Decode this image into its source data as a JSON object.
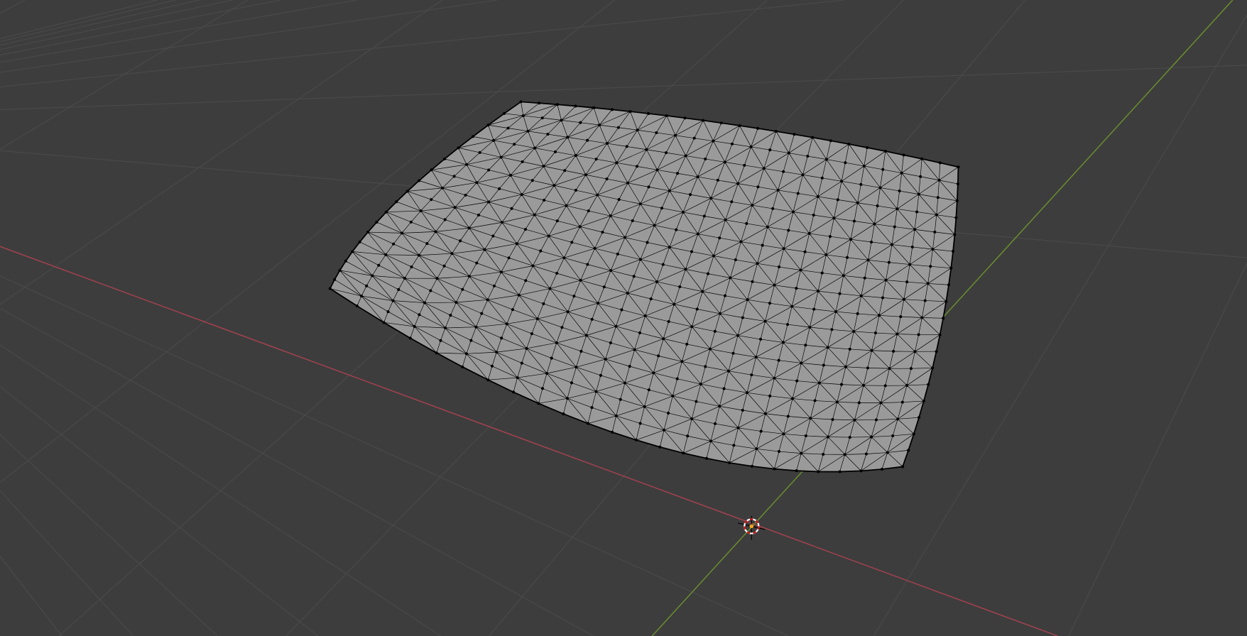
{
  "viewport": {
    "background": "#3d3d3d",
    "grid_color": "#4a4a4a",
    "x_axis_color": "#a54250",
    "y_axis_color": "#6b8f2e",
    "mesh_fill": "#9a9a9a",
    "mesh_wire": "#000000",
    "cursor_ring_a": "#ffffff",
    "cursor_ring_b": "#d01010",
    "origin_color": "#f5a020"
  }
}
